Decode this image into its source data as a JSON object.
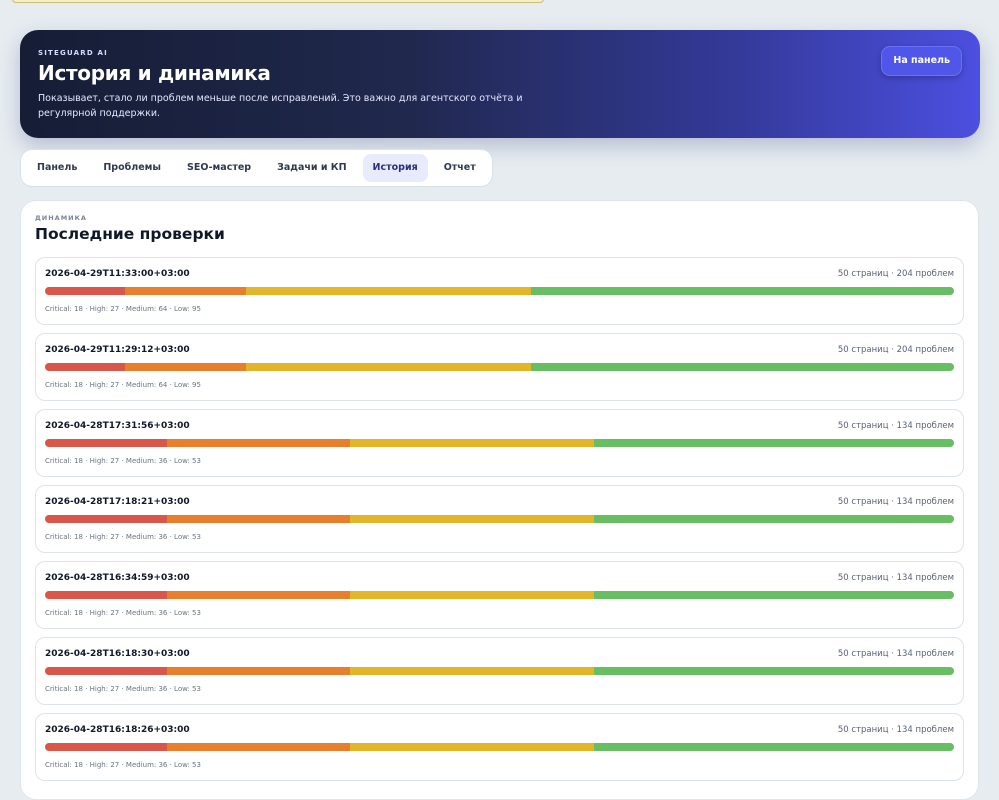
{
  "hero": {
    "eyebrow": "SITEGUARD AI",
    "title": "История и динамика",
    "description": "Показывает, стало ли проблем меньше после исправлений. Это важно для агентского отчёта и регулярной поддержки.",
    "button_label": "На панель"
  },
  "tabs": [
    {
      "label": "Панель",
      "active": false
    },
    {
      "label": "Проблемы",
      "active": false
    },
    {
      "label": "SEO-мастер",
      "active": false
    },
    {
      "label": "Задачи и КП",
      "active": false
    },
    {
      "label": "История",
      "active": true
    },
    {
      "label": "Отчет",
      "active": false
    }
  ],
  "history": {
    "eyebrow": "ДИНАМИКА",
    "title": "Последние проверки",
    "colors": {
      "critical": "#d9574a",
      "high": "#e87f2c",
      "medium": "#e2b52a",
      "low": "#67be63"
    },
    "scans": [
      {
        "date": "2026-04-29T11:33:00+03:00",
        "meta": "50 страниц · 204 проблем",
        "critical": 18,
        "high": 27,
        "medium": 64,
        "low": 95,
        "counts": "Critical: 18 · High: 27 · Medium: 64 · Low: 95"
      },
      {
        "date": "2026-04-29T11:29:12+03:00",
        "meta": "50 страниц · 204 проблем",
        "critical": 18,
        "high": 27,
        "medium": 64,
        "low": 95,
        "counts": "Critical: 18 · High: 27 · Medium: 64 · Low: 95"
      },
      {
        "date": "2026-04-28T17:31:56+03:00",
        "meta": "50 страниц · 134 проблем",
        "critical": 18,
        "high": 27,
        "medium": 36,
        "low": 53,
        "counts": "Critical: 18 · High: 27 · Medium: 36 · Low: 53"
      },
      {
        "date": "2026-04-28T17:18:21+03:00",
        "meta": "50 страниц · 134 проблем",
        "critical": 18,
        "high": 27,
        "medium": 36,
        "low": 53,
        "counts": "Critical: 18 · High: 27 · Medium: 36 · Low: 53"
      },
      {
        "date": "2026-04-28T16:34:59+03:00",
        "meta": "50 страниц · 134 проблем",
        "critical": 18,
        "high": 27,
        "medium": 36,
        "low": 53,
        "counts": "Critical: 18 · High: 27 · Medium: 36 · Low: 53"
      },
      {
        "date": "2026-04-28T16:18:30+03:00",
        "meta": "50 страниц · 134 проблем",
        "critical": 18,
        "high": 27,
        "medium": 36,
        "low": 53,
        "counts": "Critical: 18 · High: 27 · Medium: 36 · Low: 53"
      },
      {
        "date": "2026-04-28T16:18:26+03:00",
        "meta": "50 страниц · 134 проблем",
        "critical": 18,
        "high": 27,
        "medium": 36,
        "low": 53,
        "counts": "Critical: 18 · High: 27 · Medium: 36 · Low: 53"
      }
    ]
  }
}
